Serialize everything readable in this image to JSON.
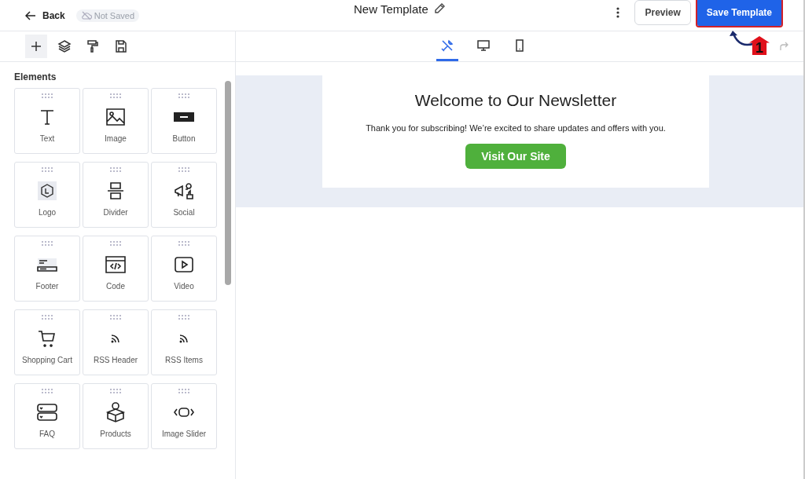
{
  "header": {
    "back": "Back",
    "save_status": "Not Saved",
    "title": "New Template",
    "preview": "Preview",
    "save": "Save Template"
  },
  "annotation": {
    "marker": "1"
  },
  "left_tools": [
    {
      "kind": "add",
      "selected": true
    },
    {
      "kind": "layers",
      "selected": false
    },
    {
      "kind": "style",
      "selected": false
    },
    {
      "kind": "save",
      "selected": false
    }
  ],
  "view_tabs": [
    {
      "kind": "tools",
      "selected": true
    },
    {
      "kind": "desktop",
      "selected": false
    },
    {
      "kind": "mobile",
      "selected": false
    }
  ],
  "sidebar": {
    "title": "Elements",
    "items": [
      {
        "kind": "text",
        "label": "Text"
      },
      {
        "kind": "image",
        "label": "Image"
      },
      {
        "kind": "button",
        "label": "Button"
      },
      {
        "kind": "logo",
        "label": "Logo"
      },
      {
        "kind": "divider",
        "label": "Divider"
      },
      {
        "kind": "social",
        "label": "Social"
      },
      {
        "kind": "footer",
        "label": "Footer"
      },
      {
        "kind": "code",
        "label": "Code"
      },
      {
        "kind": "video",
        "label": "Video"
      },
      {
        "kind": "cart",
        "label": "Shopping Cart"
      },
      {
        "kind": "rss",
        "label": "RSS Header"
      },
      {
        "kind": "rss",
        "label": "RSS Items"
      },
      {
        "kind": "faq",
        "label": "FAQ"
      },
      {
        "kind": "products",
        "label": "Products"
      },
      {
        "kind": "slider",
        "label": "Image Slider"
      }
    ]
  },
  "email": {
    "heading": "Welcome to Our Newsletter",
    "body": "Thank you for subscribing! We’re excited to share updates and offers with you.",
    "cta": "Visit Our Site"
  }
}
